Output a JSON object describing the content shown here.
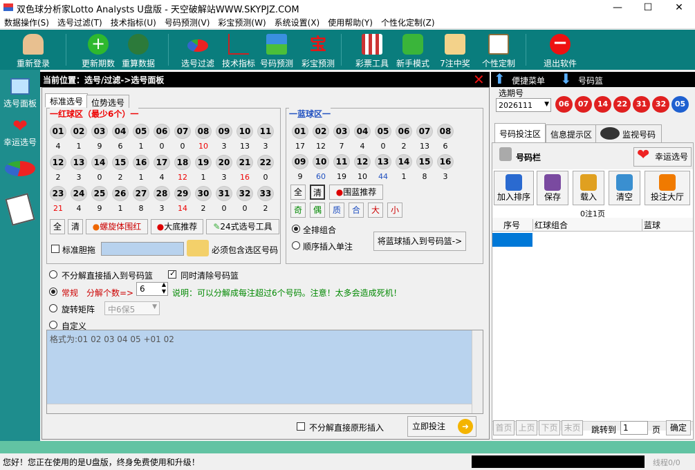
{
  "title": "双色球分析家Lotto Analysts U盘版 - 天空破解站WWW.SKYPJZ.COM",
  "window": {
    "min": "—",
    "max": "☐",
    "close": "✕"
  },
  "menu": [
    "数据操作(S)",
    "选号过滤(T)",
    "技术指标(U)",
    "号码预测(V)",
    "彩宝预测(W)",
    "系统设置(X)",
    "使用帮助(Y)",
    "个性化定制(Z)"
  ],
  "toolbar": [
    "重新登录",
    "更新期数",
    "重算数据",
    "选号过滤",
    "技术指标",
    "号码预测",
    "彩宝预测",
    "彩票工具",
    "新手模式",
    "7注中奖",
    "个性定制",
    "退出软件"
  ],
  "leftnav": [
    "选号面板",
    "幸运选号"
  ],
  "path": "当前位置：选号/过滤->选号面板",
  "quick_menu": "便捷菜单",
  "number_basket": "号码篮",
  "tabs": [
    "标准选号",
    "位势选号"
  ],
  "red": {
    "label": "一红球区（最少6个）一",
    "rows": [
      {
        "balls": [
          "01",
          "02",
          "03",
          "04",
          "05",
          "06",
          "07",
          "08",
          "09",
          "10",
          "11"
        ],
        "counts": [
          "4",
          "1",
          "9",
          "6",
          "1",
          "0",
          "0",
          "10",
          "3",
          "13",
          "3"
        ]
      },
      {
        "balls": [
          "12",
          "13",
          "14",
          "15",
          "16",
          "17",
          "18",
          "19",
          "20",
          "21",
          "22"
        ],
        "counts": [
          "2",
          "3",
          "0",
          "2",
          "1",
          "4",
          "12",
          "1",
          "3",
          "16",
          "0"
        ]
      },
      {
        "balls": [
          "23",
          "24",
          "25",
          "26",
          "27",
          "28",
          "29",
          "30",
          "31",
          "32",
          "33"
        ],
        "counts": [
          "21",
          "4",
          "9",
          "1",
          "8",
          "3",
          "14",
          "2",
          "0",
          "0",
          "2"
        ]
      }
    ],
    "red_counts": [
      "10",
      "12",
      "16",
      "21",
      "14"
    ],
    "btn_all": "全",
    "btn_clear": "清",
    "btn_spiral": "螺旋体围红",
    "btn_big": "大底推荐",
    "btn_24": "24式选号工具"
  },
  "blue": {
    "label": "一蓝球区一",
    "rows": [
      {
        "balls": [
          "01",
          "02",
          "03",
          "04",
          "05",
          "06",
          "07",
          "08"
        ],
        "counts": [
          "17",
          "12",
          "7",
          "4",
          "0",
          "2",
          "13",
          "6"
        ]
      },
      {
        "balls": [
          "09",
          "10",
          "11",
          "12",
          "13",
          "14",
          "15",
          "16"
        ],
        "counts": [
          "9",
          "60",
          "19",
          "10",
          "44",
          "1",
          "8",
          "3"
        ]
      }
    ],
    "btn_all": "全",
    "btn_clear": "清",
    "btn_recommend": "围蓝推荐",
    "filters": [
      "奇",
      "偶",
      "质",
      "合",
      "大",
      "小"
    ],
    "opt_all": "全排组合",
    "opt_seq": "顺序插入单注",
    "btn_insert": "将蓝球插入到号码篮->"
  },
  "dan": {
    "label": "标准胆拖",
    "must": "必须包含选区号码"
  },
  "options": {
    "no_split": "不分解直接插入到号码篮",
    "clear_basket": "同时清除号码篮",
    "normal": "常规",
    "split_label": "分解个数=>",
    "split_value": "6",
    "note": "说明：可以分解成每注超过6个号码。注意！太多会造成死机！",
    "rotate": "旋转矩阵",
    "rotate_value": "中6保5",
    "custom": "自定义"
  },
  "format_text": "格式为:01 02 03 04 05 +01 02",
  "bottom": {
    "no_split_orig": "不分解直接原形插入",
    "bet_now": "立即投注"
  },
  "right": {
    "issue_label": "选期号",
    "issue": "2026111",
    "red_balls": [
      "06",
      "07",
      "14",
      "22",
      "31",
      "32"
    ],
    "blue_ball": "05",
    "tabs": [
      "号码投注区",
      "信息提示区",
      "监视号码"
    ],
    "basket_title": "号码栏",
    "lucky": "幸运选号",
    "actions": [
      "加入排序",
      "保存",
      "载入",
      "清空",
      "投注大厅"
    ],
    "page_info": "0注1页",
    "cols": [
      "序号",
      "红球组合",
      "蓝球"
    ],
    "pager": [
      "首页",
      "上页",
      "下页",
      "末页"
    ],
    "goto": "跳转到",
    "page_value": "1",
    "page_unit": "页",
    "confirm": "确定"
  },
  "status": {
    "msg": "您好！您正在使用的是U盘版，终身免费使用和升级！",
    "line": "线程0/0"
  }
}
